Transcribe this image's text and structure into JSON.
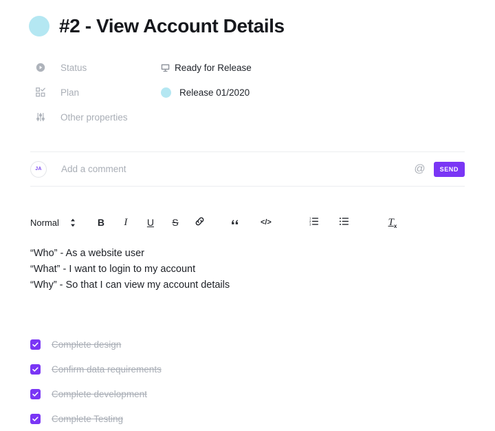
{
  "header": {
    "dot_color": "#b4e7f2",
    "title": "#2 - View Account Details"
  },
  "properties": [
    {
      "icon": "play-circle-icon",
      "label": "Status",
      "value": "Ready for Release",
      "value_icon": "monitor-icon"
    },
    {
      "icon": "grid-check-icon",
      "label": "Plan",
      "value": "Release 01/2020",
      "value_icon": "cyan-dot-icon",
      "dot_color": "#b4e7f2"
    },
    {
      "icon": "sliders-icon",
      "label": "Other properties",
      "value": "",
      "value_icon": ""
    }
  ],
  "comment": {
    "avatar_initials": "JA",
    "placeholder": "Add a comment",
    "value": "",
    "mention_icon": "at-sign-icon",
    "send_label": "SEND",
    "send_color": "#7a36f5"
  },
  "editor": {
    "style_label": "Normal",
    "tools": [
      {
        "name": "bold-button",
        "label": "B"
      },
      {
        "name": "italic-button",
        "label": "I"
      },
      {
        "name": "underline-button",
        "label": "U"
      },
      {
        "name": "strikethrough-button",
        "label": "S"
      },
      {
        "name": "link-button",
        "label": "link-icon"
      },
      {
        "name": "blockquote-button",
        "label": "quote-icon"
      },
      {
        "name": "code-button",
        "label": "</>"
      },
      {
        "name": "ordered-list-button",
        "label": "ordered-list-icon"
      },
      {
        "name": "bullet-list-button",
        "label": "bullet-list-icon"
      },
      {
        "name": "clear-format-button",
        "label": "Tx"
      }
    ],
    "code_label": "</>",
    "clear_format_label": "T",
    "clear_format_sub": "x"
  },
  "body": {
    "lines": [
      "“Who” - As a website user",
      "“What” - I want to login to my account",
      "“Why” - So that I can view my account details"
    ]
  },
  "checklist": {
    "checkbox_color": "#7a36f5",
    "items": [
      {
        "label": "Complete design",
        "checked": true
      },
      {
        "label": "Confirm data requirements",
        "checked": true
      },
      {
        "label": "Complete development",
        "checked": true
      },
      {
        "label": "Complete Testing",
        "checked": true
      }
    ]
  }
}
